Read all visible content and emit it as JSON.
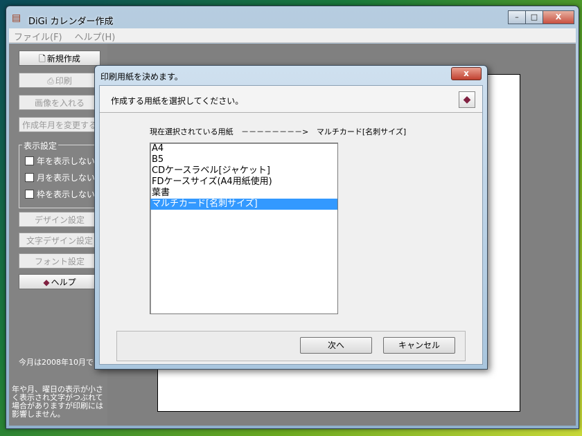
{
  "app": {
    "title": "DiGi カレンダー作成",
    "icon": "calendar-app-icon"
  },
  "window_controls": {
    "minimize": "–",
    "maximize": "□",
    "close": "X"
  },
  "menu": {
    "items": [
      "ファイル(F)",
      "ヘルプ(H)"
    ]
  },
  "sidebar": {
    "new_button": "新規作成",
    "print_button": "印刷",
    "image_button": "画像を入れる",
    "date_button": "作成年月を変更する",
    "display_group": {
      "label": "表示設定",
      "options": [
        "年を表示しない",
        "月を表示しない",
        "枠を表示しない"
      ]
    },
    "design_button": "デザイン設定",
    "text_design_button": "文字デザイン設定",
    "font_button": "フォント設定",
    "help_button": "ヘルプ",
    "month_info": "今月は2008年10月で",
    "note": "年や月、曜日の表示が小さく表示され文字がつぶれて場合がありますが印刷には影響しません。"
  },
  "dialog": {
    "title": "印刷用紙を決めます。",
    "close_label": "x",
    "instruction": "作成する用紙を選択してください。",
    "current_label": "現在選択されている用紙",
    "arrow": "－－－－－－－－>",
    "current_value": "マルチカード[名刺サイズ]",
    "paper_options": [
      "A4",
      "B5",
      "CDケースラベル[ジャケット]",
      "FDケースサイズ(A4用紙使用)",
      "葉書",
      "マルチカード[名刺サイズ]"
    ],
    "selected_option": "マルチカード[名刺サイズ]",
    "next_button": "次へ",
    "cancel_button": "キャンセル"
  },
  "colors": {
    "selection": "#3399ff",
    "panel": "#838383",
    "desktop_accent": "#6aa820"
  }
}
